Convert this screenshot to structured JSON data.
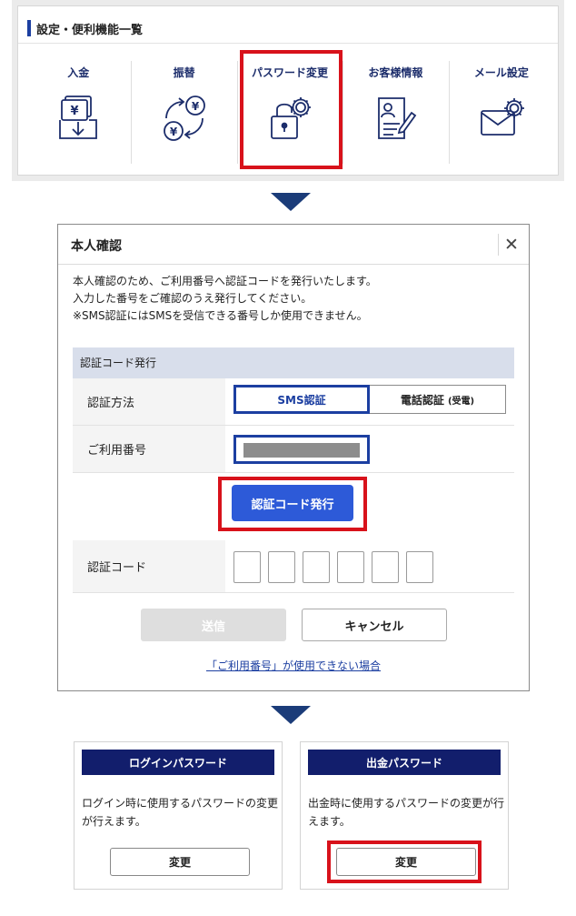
{
  "top_panel": {
    "title": "設定・便利機能一覧",
    "items": [
      {
        "label": "入金",
        "icon": "deposit-yen-icon"
      },
      {
        "label": "振替",
        "icon": "transfer-yen-icon"
      },
      {
        "label": "パスワード変更",
        "icon": "password-lock-gear-icon"
      },
      {
        "label": "お客様情報",
        "icon": "customer-info-icon"
      },
      {
        "label": "メール設定",
        "icon": "mail-settings-icon"
      }
    ]
  },
  "modal": {
    "title": "本人確認",
    "close_symbol": "✕",
    "description": [
      "本人確認のため、ご利用番号へ認証コードを発行いたします。",
      "入力した番号をご確認のうえ発行してください。",
      "※SMS認証にはSMSを受信できる番号しか使用できません。"
    ],
    "section_title": "認証コード発行",
    "method_label": "認証方法",
    "method_sms": "SMS認証",
    "method_tel": "電話認証",
    "method_tel_sub": "(受電)",
    "number_label": "ご利用番号",
    "issue_button": "認証コード発行",
    "code_label": "認証コード",
    "send_button": "送信",
    "cancel_button": "キャンセル",
    "help_link": "「ご利用番号」が使用できない場合"
  },
  "cards": [
    {
      "title": "ログインパスワード",
      "text": "ログイン時に使用するパスワードの変更が行えます。",
      "button": "変更"
    },
    {
      "title": "出金パスワード",
      "text": "出金時に使用するパスワードの変更が行えます。",
      "button": "変更"
    }
  ],
  "colors": {
    "brand_navy": "#1b3c79",
    "accent_blue": "#1c3fa1",
    "button_blue": "#2d5ad8",
    "highlight_red": "#d8121b",
    "card_header": "#121e6c"
  }
}
